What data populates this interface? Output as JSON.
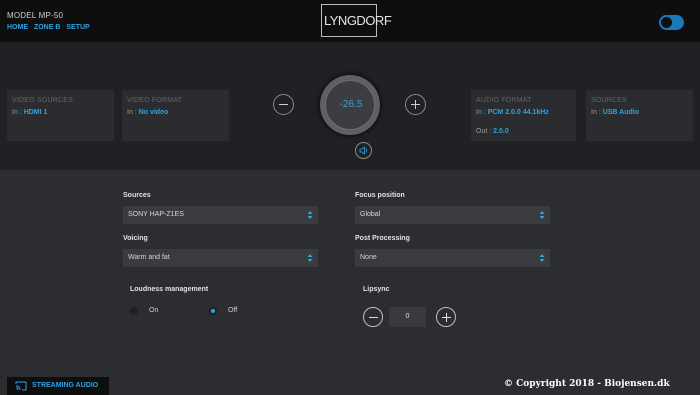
{
  "header": {
    "model": "MODEL MP-50",
    "nav": [
      "HOME",
      "ZONE B",
      "SETUP"
    ],
    "logo_text": "LYNGDORF",
    "power_toggle": "on"
  },
  "status_cards": {
    "video_sources": {
      "title": "VIDEO SOURCES",
      "prefix": "In :",
      "value": "HDMI 1"
    },
    "video_format": {
      "title": "VIDEO FORMAT",
      "prefix": "In :",
      "value": "No video"
    },
    "audio_format": {
      "title": "AUDIO FORMAT",
      "in_prefix": "In :",
      "in_value": "PCM 2.0.0 44.1kHz",
      "out_prefix": "Out :",
      "out_value": "2.0.0"
    },
    "sources": {
      "title": "SOURCES",
      "prefix": "In :",
      "value": "USB Audio"
    }
  },
  "volume": {
    "value": "-26.5"
  },
  "settings": {
    "sources": {
      "label": "Sources",
      "value": "SONY HAP-Z1ES"
    },
    "focus": {
      "label": "Focus position",
      "value": "Global"
    },
    "voicing": {
      "label": "Voicing",
      "value": "Warm and fat"
    },
    "post": {
      "label": "Post Processing",
      "value": "None"
    },
    "loudness": {
      "label": "Loudness management",
      "on_label": "On",
      "off_label": "Off",
      "selected": "Off"
    },
    "lipsync": {
      "label": "Lipsync",
      "value": "0"
    }
  },
  "streaming": {
    "label": "STREAMING AUDIO"
  },
  "copyright": "© Copyright 2018 - Biojensen.dk",
  "colors": {
    "accent": "#2ea3e3",
    "background": "#2c2d30",
    "topbar": "#0e0e0f"
  }
}
